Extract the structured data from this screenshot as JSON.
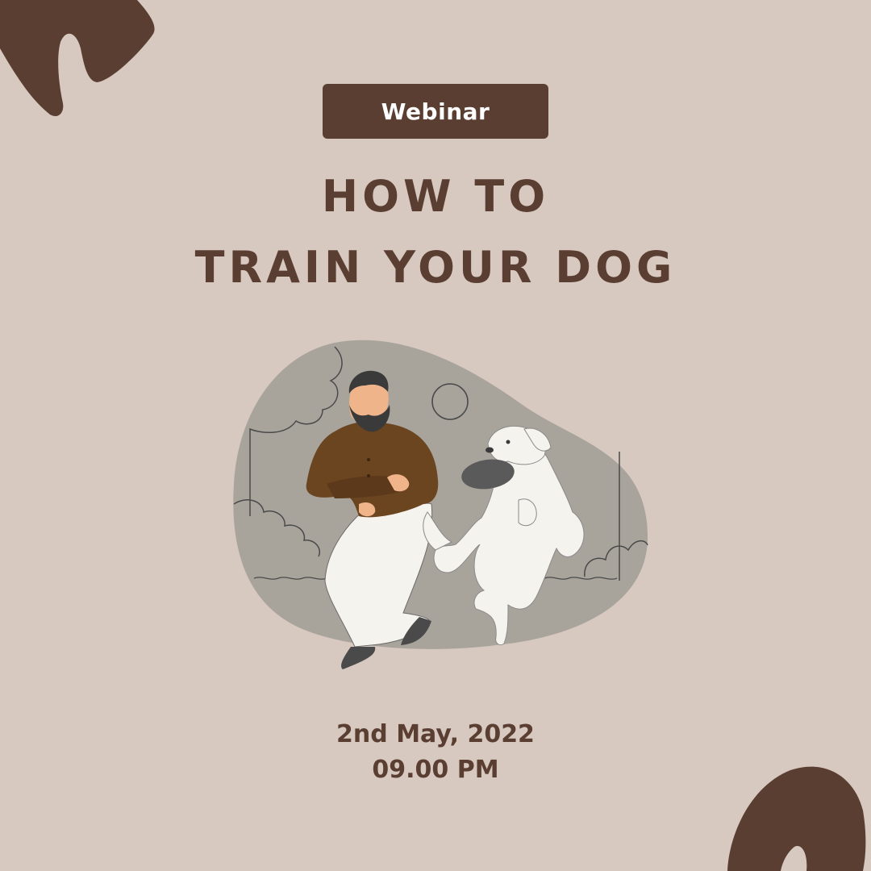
{
  "badge": {
    "label": "Webinar"
  },
  "title": {
    "line1": "HOW TO",
    "line2": "TRAIN YOUR DOG"
  },
  "event": {
    "date": "2nd May, 2022",
    "time": "09.00 PM"
  },
  "colors": {
    "background": "#d7c8c0",
    "accent": "#5a3e32",
    "illustration_bg": "#a8a49c",
    "shirt": "#6b4420",
    "dog": "#f5f3ee"
  },
  "illustration": {
    "subject": "man-playing-with-dog",
    "items": [
      "bearded-man",
      "white-dog",
      "frisbee",
      "trees",
      "sun"
    ]
  }
}
